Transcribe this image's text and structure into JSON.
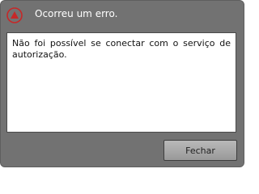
{
  "dialog": {
    "title": "Ocorreu um erro.",
    "icon": "warning-triangle-icon",
    "message": "Não foi possível se conectar com o serviço de autorização.",
    "close_label": "Fechar"
  },
  "colors": {
    "background": "#727272",
    "icon_red": "#c62828",
    "button_top": "#b9b9b9",
    "button_bottom": "#999999"
  }
}
